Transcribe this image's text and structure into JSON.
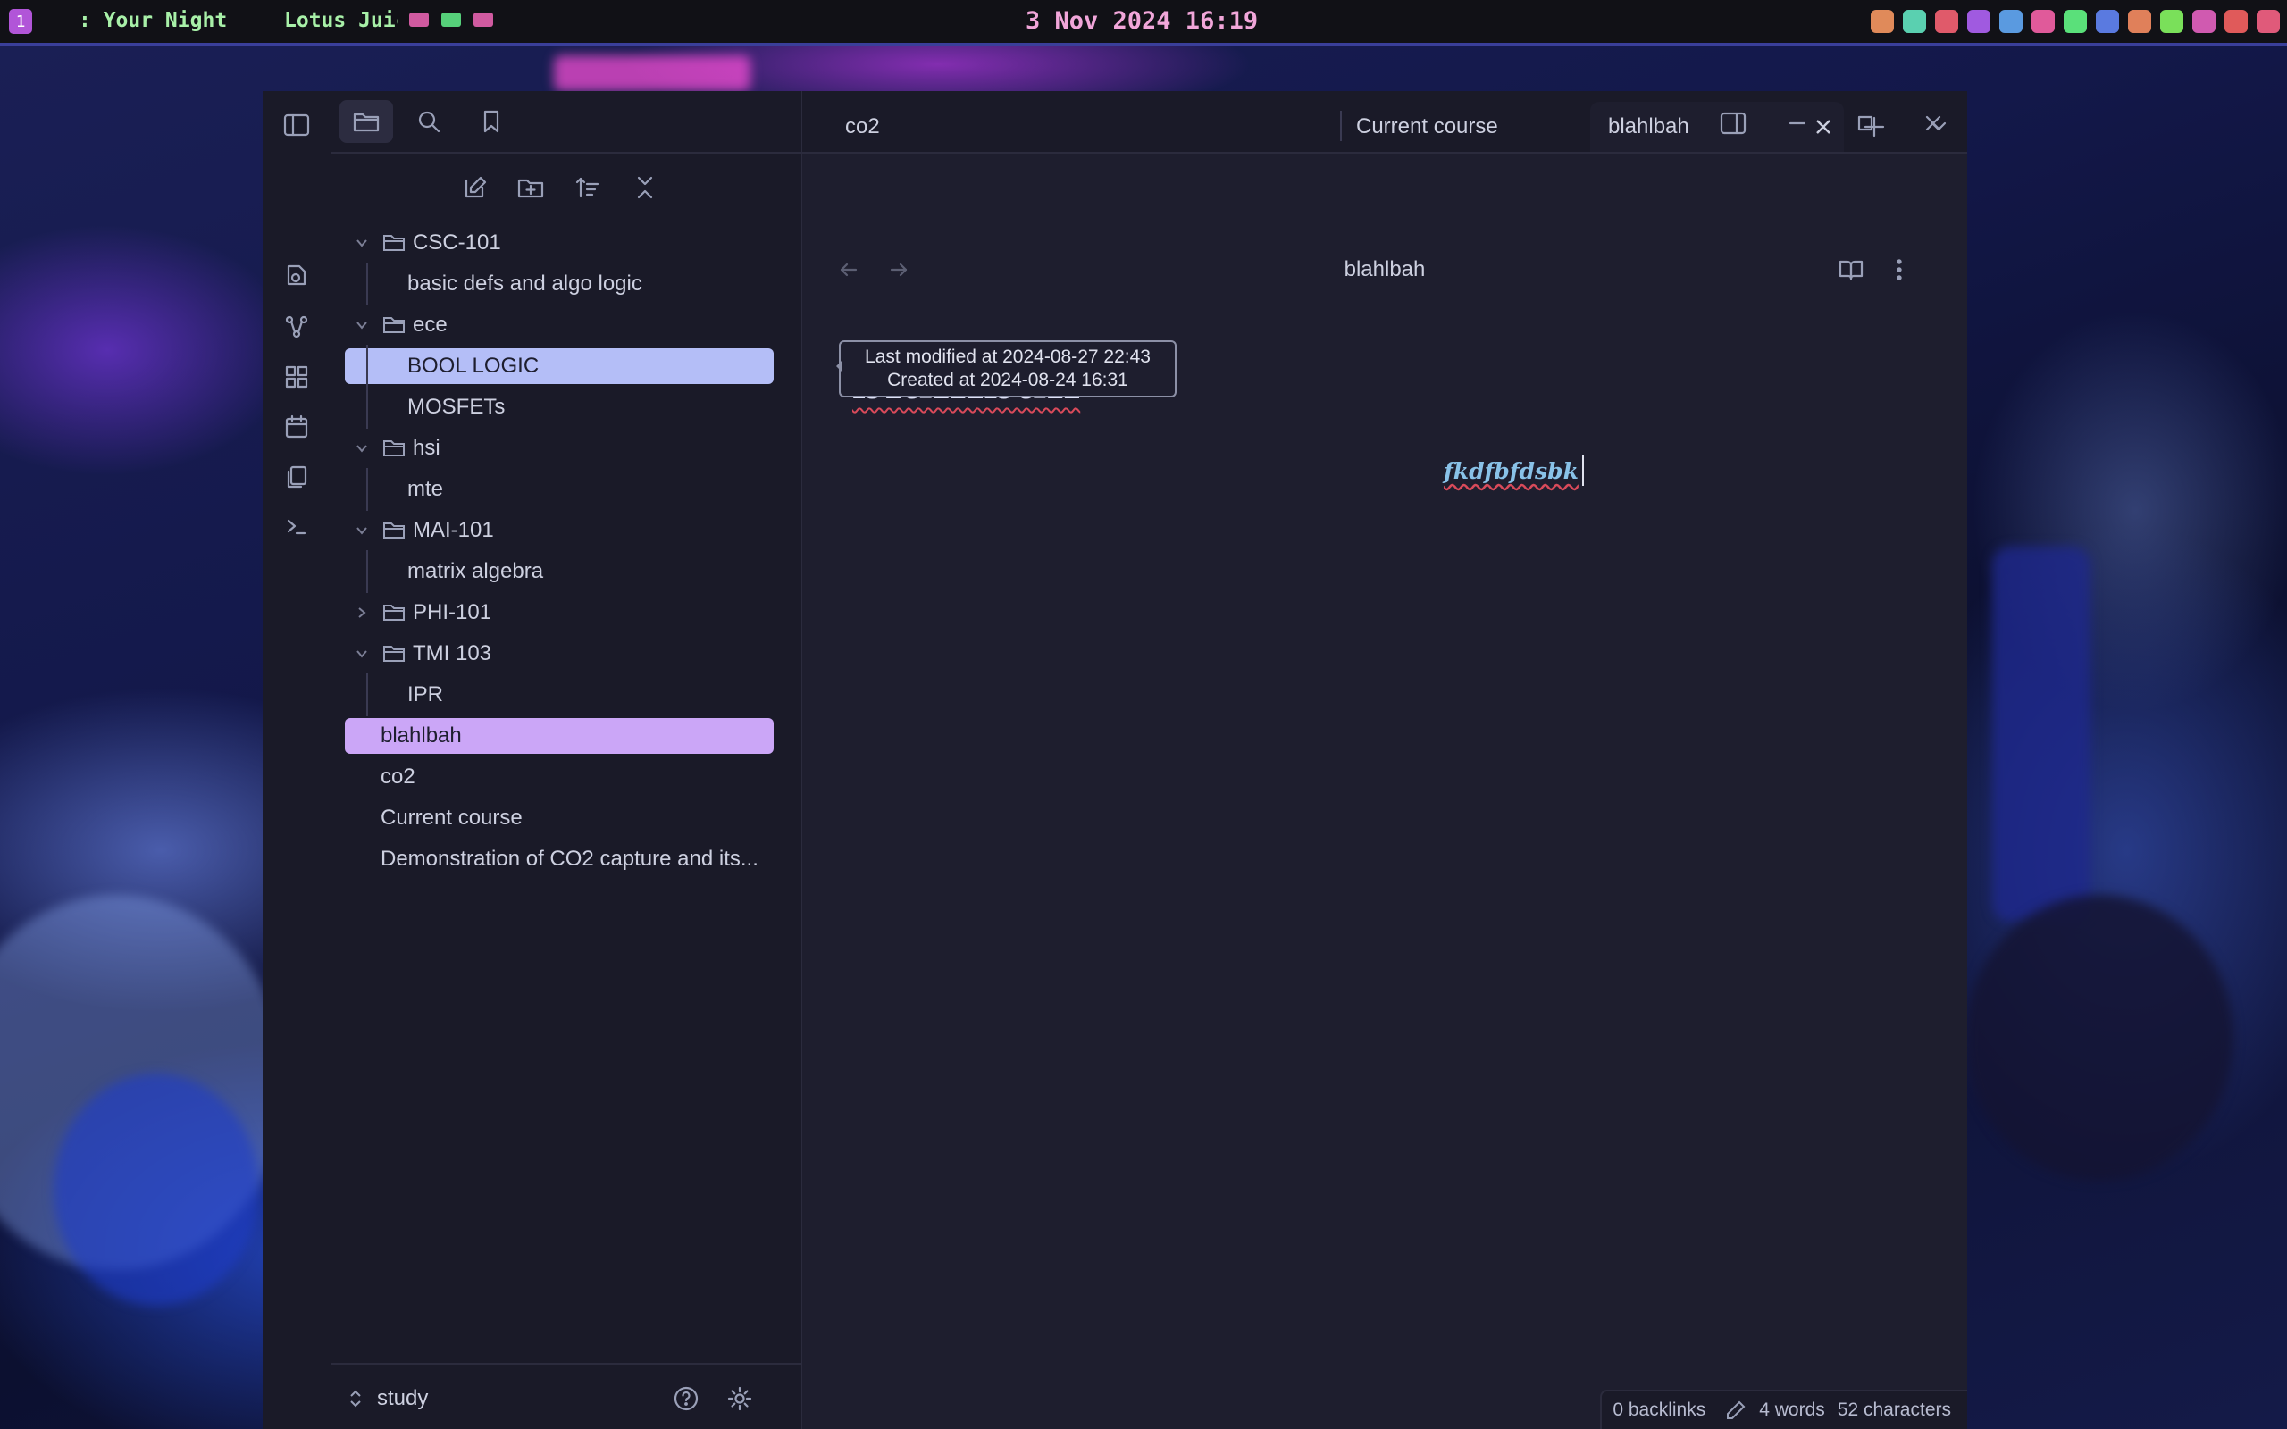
{
  "topbar": {
    "workspace": "1",
    "now_playing_1": ": Your Night",
    "now_playing_2": "Lotus Juice",
    "clock": "3 Nov 2024 16:19"
  },
  "ribbon": {
    "icons": [
      "open-note-icon",
      "graph-view-icon",
      "canvas-icon",
      "daily-note-icon",
      "templates-icon",
      "command-palette-icon"
    ]
  },
  "sidebar": {
    "top_icons": [
      "sidebar-toggle-icon",
      "files-icon",
      "search-icon",
      "bookmark-icon"
    ],
    "nav_actions": [
      "new-note-icon",
      "new-folder-icon",
      "sort-icon",
      "collapse-all-icon"
    ],
    "tree": [
      {
        "label": "CSC-101",
        "type": "folder",
        "expanded": true
      },
      {
        "label": "basic defs and algo logic",
        "type": "file",
        "child": true
      },
      {
        "label": "ece",
        "type": "folder",
        "expanded": true
      },
      {
        "label": "BOOL LOGIC",
        "type": "file",
        "child": true,
        "selected": "hover"
      },
      {
        "label": "MOSFETs",
        "type": "file",
        "child": true
      },
      {
        "label": "hsi",
        "type": "folder",
        "expanded": true
      },
      {
        "label": "mte",
        "type": "file",
        "child": true
      },
      {
        "label": "MAI-101",
        "type": "folder",
        "expanded": true
      },
      {
        "label": "matrix algebra",
        "type": "file",
        "child": true
      },
      {
        "label": "PHI-101",
        "type": "folder",
        "expanded": false
      },
      {
        "label": "TMI 103",
        "type": "folder",
        "expanded": true
      },
      {
        "label": "IPR",
        "type": "file",
        "child": true
      },
      {
        "label": "blahlbah",
        "type": "file",
        "root": true,
        "selected": "active"
      },
      {
        "label": "co2",
        "type": "file",
        "root": true
      },
      {
        "label": "Current course",
        "type": "file",
        "root": true
      },
      {
        "label": "Demonstration of CO2 capture and its...",
        "type": "file",
        "root": true
      }
    ],
    "vault_name": "study"
  },
  "tabs": [
    {
      "label": "co2"
    },
    {
      "label": "Current course"
    },
    {
      "label": "blahlbah",
      "active": true
    }
  ],
  "editor": {
    "header_title": "blahlbah",
    "note_title": "blahlbah",
    "body_text": "fkdfbfdsbk",
    "tooltip_modified": "Last modified at 2024-08-27 22:43",
    "tooltip_created": "Created at 2024-08-24 16:31"
  },
  "status": {
    "backlinks": "0 backlinks",
    "words": "4 words",
    "characters": "52 characters"
  },
  "colors": {
    "accent_purple": "#cba6f7",
    "accent_blue": "#b4bef7",
    "background": "#1e1e2e",
    "clock": "#f1a6d9"
  }
}
